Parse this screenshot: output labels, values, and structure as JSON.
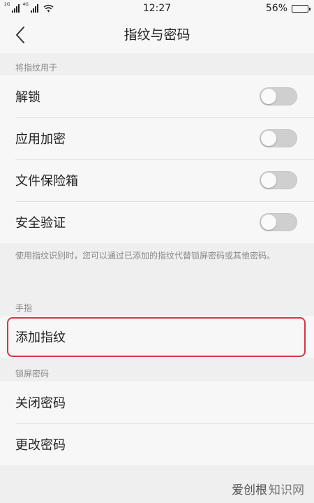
{
  "status_bar": {
    "network_top": "2G",
    "network_2": "4G",
    "time": "12:27",
    "battery_text": "56%",
    "battery_level": 0.56
  },
  "header": {
    "back_icon": "chevron-left-icon",
    "title": "指纹与密码"
  },
  "fingerprint_usage": {
    "label": "将指纹用于",
    "items": [
      {
        "label": "解锁",
        "enabled": false
      },
      {
        "label": "应用加密",
        "enabled": false
      },
      {
        "label": "文件保险箱",
        "enabled": false
      },
      {
        "label": "安全验证",
        "enabled": false
      }
    ],
    "note": "使用指纹识别时，您可以通过已添加的指纹代替锁屏密码或其他密码。"
  },
  "finger": {
    "label": "手指",
    "add_label": "添加指纹"
  },
  "lock_password": {
    "label": "锁屏密码",
    "items": [
      {
        "label": "关闭密码"
      },
      {
        "label": "更改密码"
      }
    ]
  },
  "watermark": {
    "part1": "爱创根",
    "part2": "知识网"
  },
  "colors": {
    "highlight": "#d83545",
    "toggle_off": "#cfcfcf",
    "background": "#efeff0",
    "card": "#f7f7f7"
  }
}
